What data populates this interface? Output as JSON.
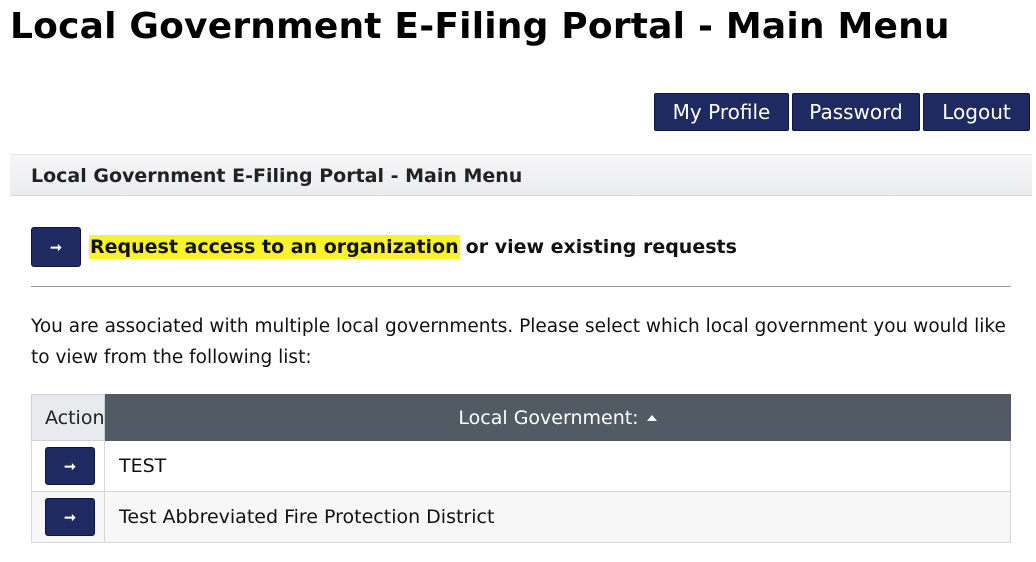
{
  "page": {
    "title": "Local Government E-Filing Portal - Main Menu"
  },
  "top_nav": {
    "my_profile": "My Profile",
    "password": "Password",
    "logout": "Logout"
  },
  "section": {
    "header": "Local Government E-Filing Portal - Main Menu"
  },
  "request_access": {
    "arrow_icon": "right-arrow-icon",
    "link_text": "Request access to an organization",
    "rest_text": "or view existing requests"
  },
  "intro": {
    "text": "You are associated with multiple local governments. Please select which local government you would like to view from the following list:"
  },
  "table": {
    "headers": {
      "action": "Action",
      "local_government": "Local Government:"
    },
    "sort_icon": "sort-ascending-icon",
    "rows": [
      {
        "name": "TEST"
      },
      {
        "name": "Test Abbreviated Fire Protection District"
      }
    ]
  },
  "colors": {
    "primary_button": "#1f2a63",
    "table_header": "#525a63",
    "highlight": "#f7f42a"
  },
  "glyphs": {
    "arrow": "➞"
  }
}
